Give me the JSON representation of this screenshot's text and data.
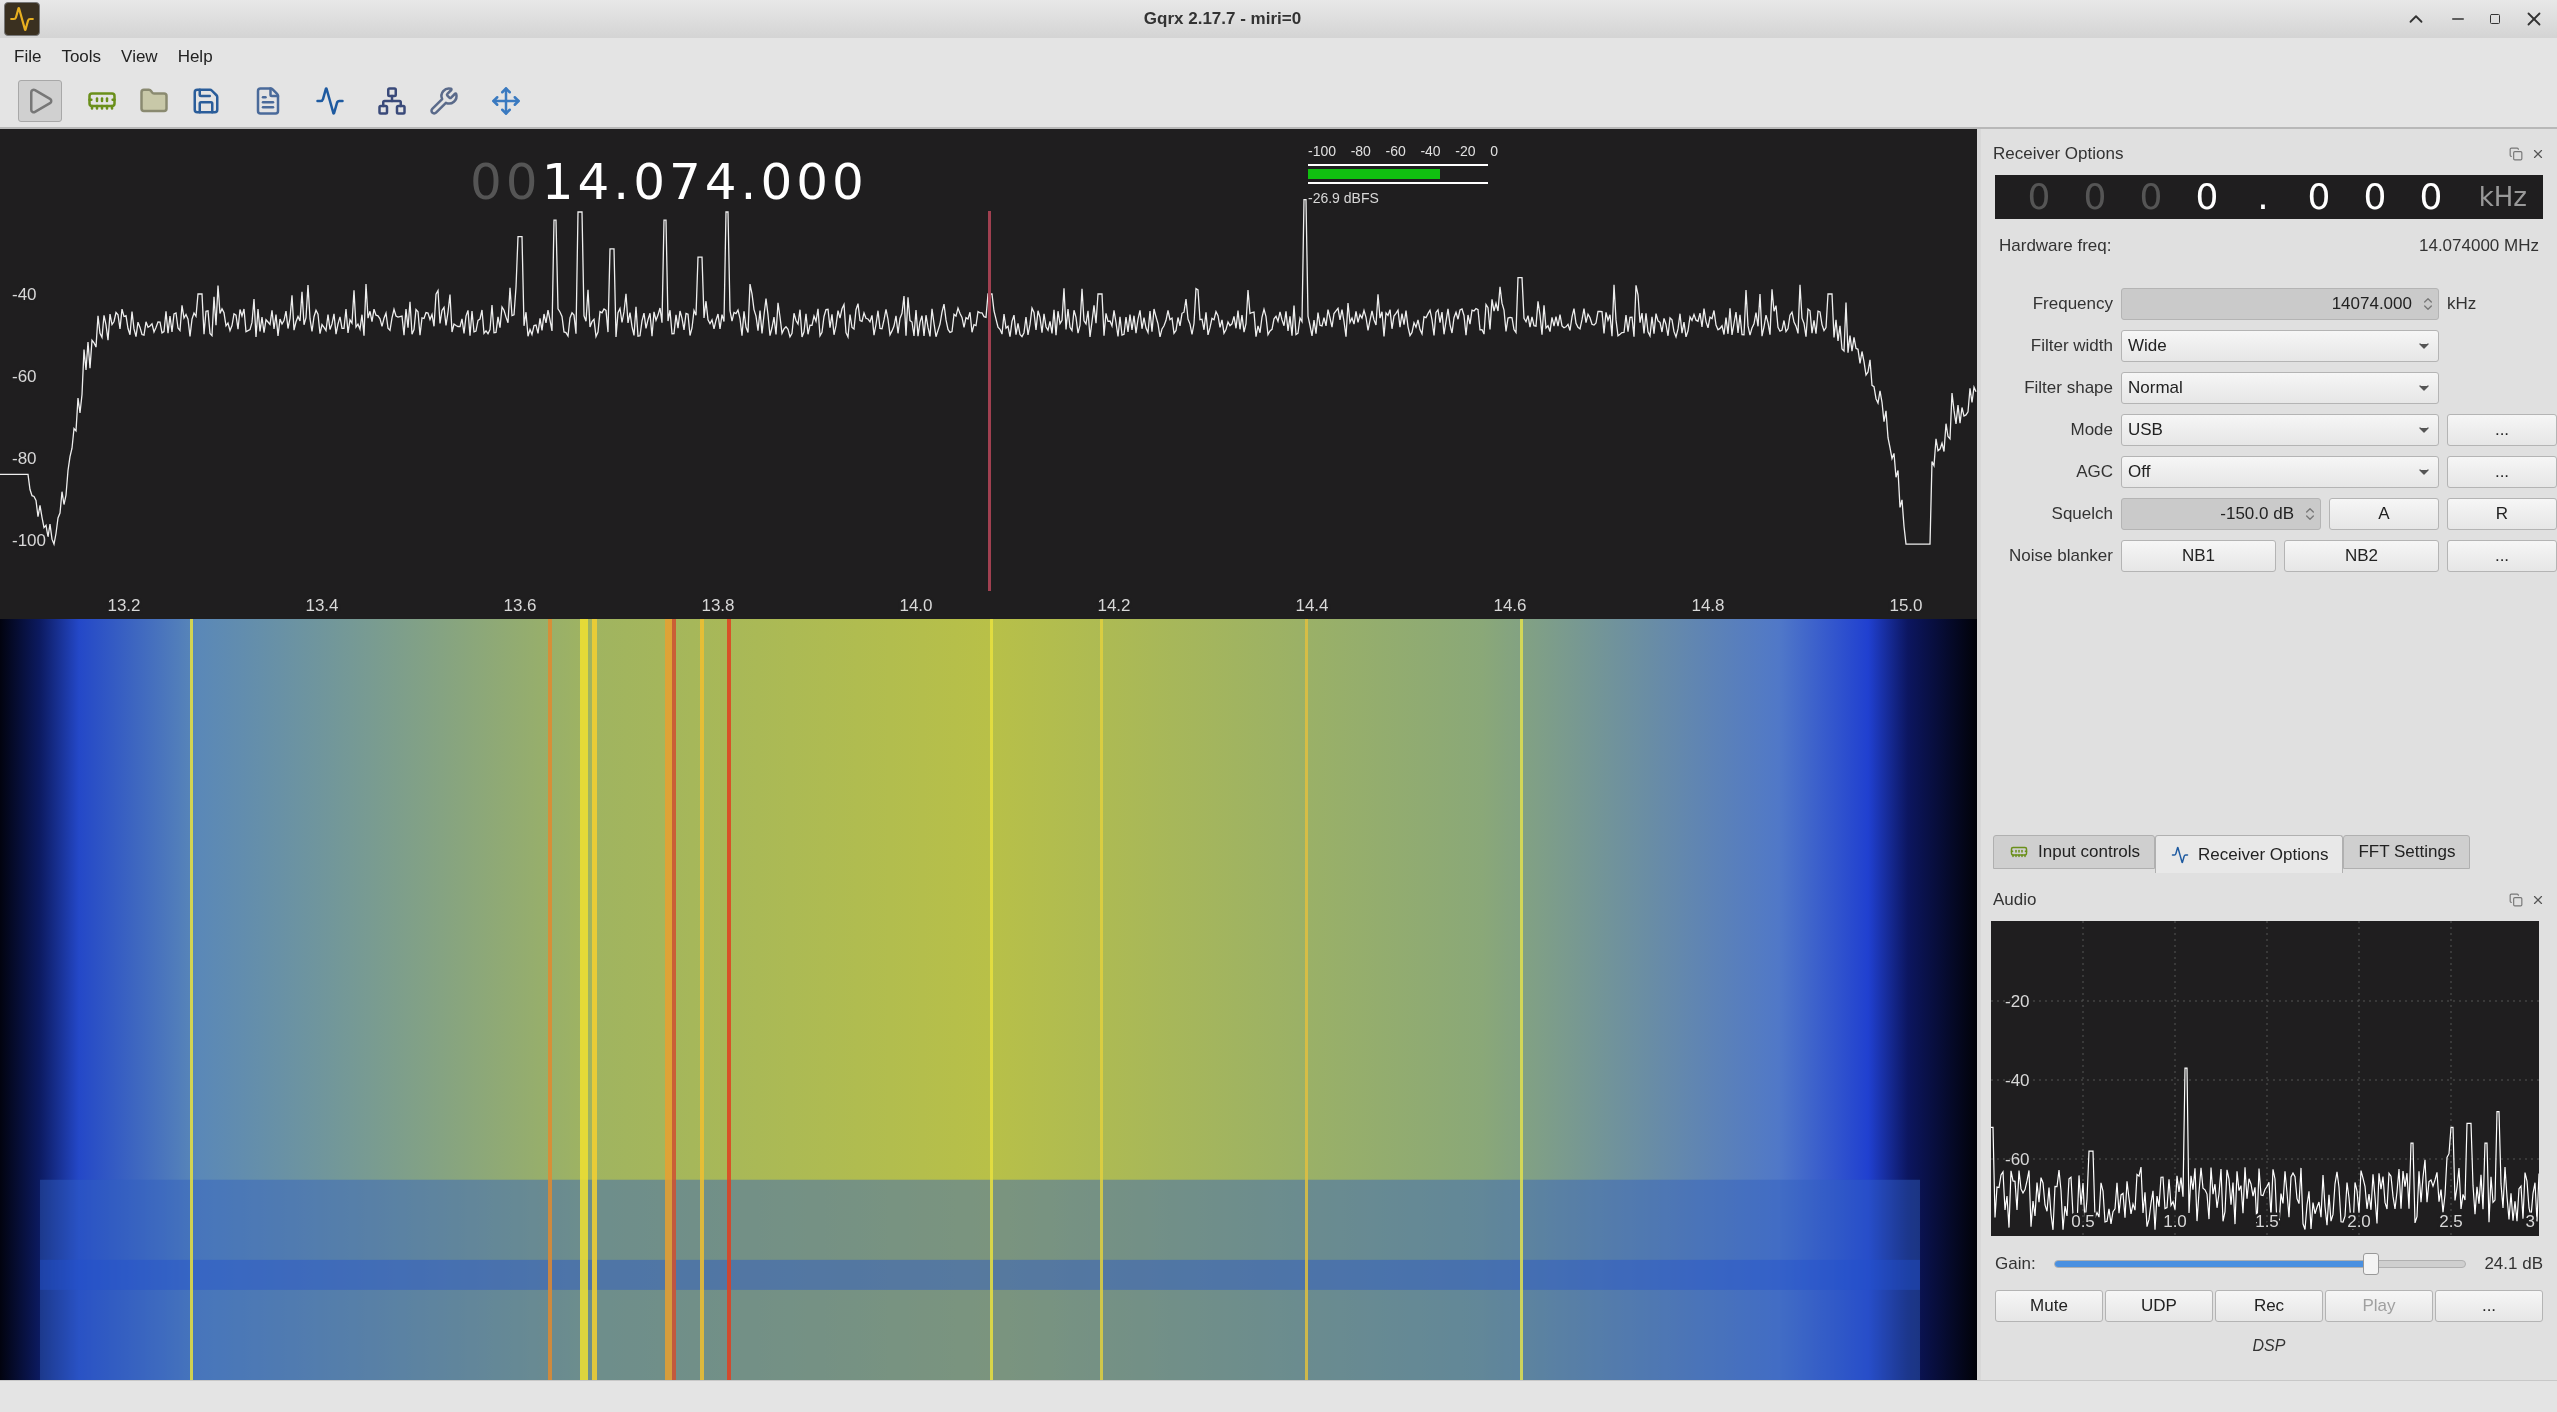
{
  "window": {
    "title": "Gqrx 2.17.7 - miri=0"
  },
  "menu": [
    "File",
    "Tools",
    "View",
    "Help"
  ],
  "toolbar": [
    {
      "kind": "play",
      "pressed": true
    },
    {
      "kind": "device",
      "pressed": false
    },
    {
      "kind": "open",
      "pressed": false
    },
    {
      "kind": "save",
      "pressed": false
    },
    {
      "kind": "bookmark",
      "pressed": false
    },
    {
      "kind": "monitor",
      "pressed": false
    },
    {
      "kind": "network",
      "pressed": false
    },
    {
      "kind": "tools",
      "pressed": false
    },
    {
      "kind": "fullscreen",
      "pressed": false
    }
  ],
  "frequency_display": {
    "leading": [
      "0",
      "0"
    ],
    "value": "14.074.000"
  },
  "signal_meter": {
    "ticks": [
      "-100",
      "-80",
      "-60",
      "-40",
      "-20",
      "0"
    ],
    "level": 0.731,
    "reading": "-26.9 dBFS"
  },
  "spectrum": {
    "y_labels": [
      "-40",
      "-60",
      "-80",
      "-100"
    ],
    "x_labels": [
      "13.2",
      "13.4",
      "13.6",
      "13.8",
      "14.0",
      "14.2",
      "14.4",
      "14.6",
      "14.8",
      "15.0"
    ]
  },
  "receiver_options": {
    "title": "Receiver Options",
    "offset_display": {
      "digits": [
        {
          "d": "0",
          "dim": true
        },
        {
          "d": "0",
          "dim": true
        },
        {
          "d": "0",
          "dim": true
        },
        {
          "d": "0",
          "dim": false
        },
        {
          "d": ".",
          "dim": false
        },
        {
          "d": "0",
          "dim": false
        },
        {
          "d": "0",
          "dim": false
        },
        {
          "d": "0",
          "dim": false
        }
      ],
      "unit": "kHz"
    },
    "hardware_freq": {
      "label": "Hardware freq:",
      "value": "14.074000 MHz"
    },
    "rows": [
      {
        "label": "Frequency",
        "kind": "spinbox",
        "value": "14074.000",
        "unit": "kHz"
      },
      {
        "label": "Filter width",
        "kind": "combo",
        "value": "Wide"
      },
      {
        "label": "Filter shape",
        "kind": "combo",
        "value": "Normal"
      },
      {
        "label": "Mode",
        "kind": "combo",
        "value": "USB",
        "buttons": [
          "..."
        ]
      },
      {
        "label": "AGC",
        "kind": "combo",
        "value": "Off",
        "buttons": [
          "..."
        ]
      },
      {
        "label": "Squelch",
        "kind": "short_spinbox",
        "value": "-150.0 dB",
        "buttons": [
          "A",
          "R"
        ]
      },
      {
        "label": "Noise blanker",
        "kind": "buttons",
        "buttons": [
          "NB1",
          "NB2",
          "..."
        ]
      }
    ]
  },
  "tabs": [
    {
      "label": "Input controls",
      "kind": "device",
      "selected": false
    },
    {
      "label": "Receiver Options",
      "kind": "monitor",
      "selected": true
    },
    {
      "label": "FFT Settings",
      "kind": "none",
      "selected": false
    }
  ],
  "audio": {
    "title": "Audio",
    "y_labels": [
      "-20",
      "-40",
      "-60"
    ],
    "x_labels": [
      "0.5",
      "1.0",
      "1.5",
      "2.0",
      "2.5",
      "3"
    ],
    "gain": {
      "label": "Gain:",
      "level": 0.77,
      "reading": "24.1 dB"
    },
    "buttons": [
      {
        "label": "Mute",
        "disabled": false
      },
      {
        "label": "UDP",
        "disabled": false
      },
      {
        "label": "Rec",
        "disabled": false
      },
      {
        "label": "Play",
        "disabled": true
      },
      {
        "label": "...",
        "disabled": false
      }
    ],
    "footer": "DSP"
  }
}
